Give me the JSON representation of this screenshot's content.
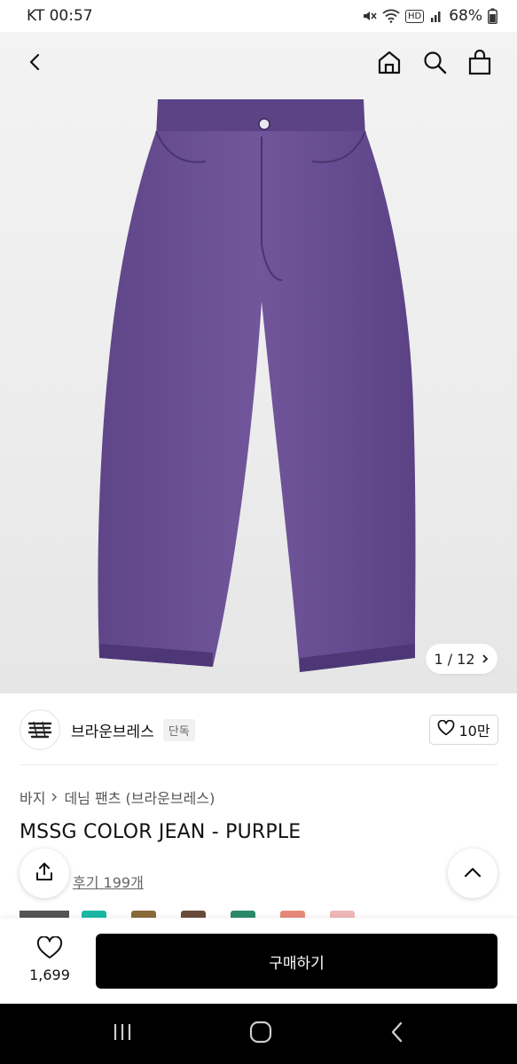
{
  "status_bar": {
    "carrier_time": "KT 00:57",
    "hd_label": "HD",
    "battery": "68%"
  },
  "gallery": {
    "pager_text": "1 / 12"
  },
  "brand": {
    "name": "브라운브레스",
    "badge": "단독",
    "like_count": "10만"
  },
  "breadcrumb": {
    "items": [
      "바지",
      "데님 팬츠 (브라운브레스)"
    ]
  },
  "product": {
    "title": "MSSG COLOR JEAN - PURPLE",
    "review_text": "후기 199개"
  },
  "swatch_colors": [
    "#555555",
    "#1bb8a5",
    "#8a6a3a",
    "#6a4b3a",
    "#2a8a6a",
    "#e98a7a",
    "#f0b7b7"
  ],
  "bottom_bar": {
    "fav_count": "1,699",
    "buy_label": "구매하기"
  },
  "colors": {
    "product_purple": "#6a4f94",
    "button_black": "#000000"
  },
  "icons": [
    "back-icon",
    "home-icon",
    "search-icon",
    "bag-icon",
    "heart-icon",
    "share-icon",
    "chevron-up-icon",
    "recent-apps-icon",
    "home-nav-icon",
    "back-nav-icon"
  ]
}
